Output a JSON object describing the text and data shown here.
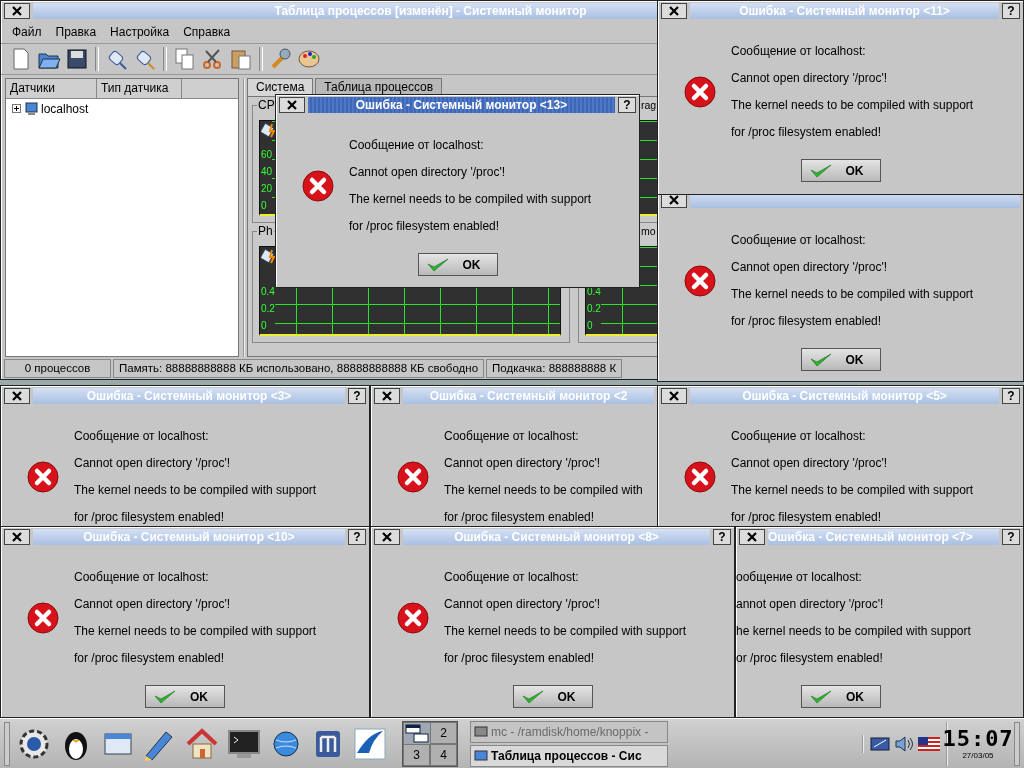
{
  "main_window": {
    "title": "Таблица процессов [изменён] - Системный монитор",
    "menu": [
      "Файл",
      "Правка",
      "Настройка",
      "Справка"
    ],
    "tree_columns": [
      "Датчики",
      "Тип датчика"
    ],
    "tree": [
      {
        "label": "localhost",
        "expanded": false
      }
    ],
    "tabs": [
      {
        "label": "Система",
        "selected": true
      },
      {
        "label": "Таблица процессов",
        "selected": false
      }
    ],
    "frames": [
      {
        "title": "CP",
        "y_labels": [
          "60",
          "40",
          "20",
          "0"
        ]
      },
      {
        "title": "rag"
      },
      {
        "title": "Ph",
        "y_labels": [
          "0.4",
          "0.2",
          "0"
        ]
      },
      {
        "title": "mo",
        "y_labels": [
          "0.4",
          "0.2",
          "0"
        ]
      }
    ],
    "status_bar": [
      "0 процессов",
      "Память: 88888888888 КБ использовано, 88888888888 КБ свободно",
      "Подкачка: 888888888 К"
    ]
  },
  "dialogs": [
    {
      "title": "Ошибка - Системный монитор <13>",
      "active": true,
      "help": "?",
      "icon": true,
      "lines": [
        "Сообщение от localhost:",
        "Cannot open directory '/proc'!",
        "The kernel needs to be compiled with support",
        "for /proc filesystem enabled!"
      ],
      "ok_button": "OK"
    },
    {
      "title": "Ошибка - Системный монитор <11>",
      "active": false,
      "help": "?",
      "icon": true,
      "lines": [
        "Сообщение от localhost:",
        "Cannot open directory '/proc'!",
        "The kernel needs to be compiled with support",
        "for /proc filesystem enabled!"
      ],
      "ok_button": "OK"
    },
    {
      "active": false,
      "icon": true,
      "lines": [
        "Сообщение от localhost:",
        "Cannot open directory '/proc'!",
        "The kernel needs to be compiled with support",
        "for /proc filesystem enabled!"
      ],
      "ok_button": "OK"
    },
    {
      "title": "Ошибка - Системный монитор <3>",
      "active": false,
      "help": "?",
      "icon": true,
      "lines": [
        "Сообщение от localhost:",
        "Cannot open directory '/proc'!",
        "The kernel needs to be compiled with support",
        "for /proc filesystem enabled!"
      ]
    },
    {
      "title": "Ошибка - Системный монитор <2",
      "active": false,
      "icon": true,
      "lines": [
        "Сообщение от localhost:",
        "Cannot open directory '/proc'!",
        "The kernel needs to be compiled with",
        "for /proc filesystem enabled!"
      ]
    },
    {
      "title": "Ошибка - Системный монитор <5>",
      "active": false,
      "help": "?",
      "icon": true,
      "lines": [
        "Сообщение от localhost:",
        "Cannot open directory '/proc'!",
        "The kernel needs to be compiled with support",
        "for /proc filesystem enabled!"
      ]
    },
    {
      "title": "Ошибка - Системный монитор <10>",
      "active": false,
      "help": "?",
      "icon": true,
      "lines": [
        "Сообщение от localhost:",
        "Cannot open directory '/proc'!",
        "The kernel needs to be compiled with support",
        "for /proc filesystem enabled!"
      ],
      "ok_button": "OK"
    },
    {
      "title": "Ошибка - Системный монитор <8>",
      "active": false,
      "help": "?",
      "icon": true,
      "lines": [
        "Сообщение от localhost:",
        "Cannot open directory '/proc'!",
        "The kernel needs to be compiled with support",
        "for /proc filesystem enabled!"
      ],
      "ok_button": "OK"
    },
    {
      "title": "Ошибка - Системный монитор <7>",
      "active": false,
      "help": "?",
      "icon": false,
      "lines": [
        "ообщение от localhost:",
        "annot open directory '/proc'!",
        "he kernel needs to be compiled with support",
        "or /proc filesystem enabled!"
      ],
      "ok_button": "OK"
    }
  ],
  "taskbar": {
    "desktops": [
      "2",
      "3",
      "4"
    ],
    "tasks": [
      {
        "label": "mc - /ramdisk/home/knoppix - ",
        "selected": false
      },
      {
        "label": "Таблица процессов - Сис",
        "selected": true
      }
    ],
    "clock": {
      "time": "15:07",
      "date": "27/03/05"
    }
  }
}
